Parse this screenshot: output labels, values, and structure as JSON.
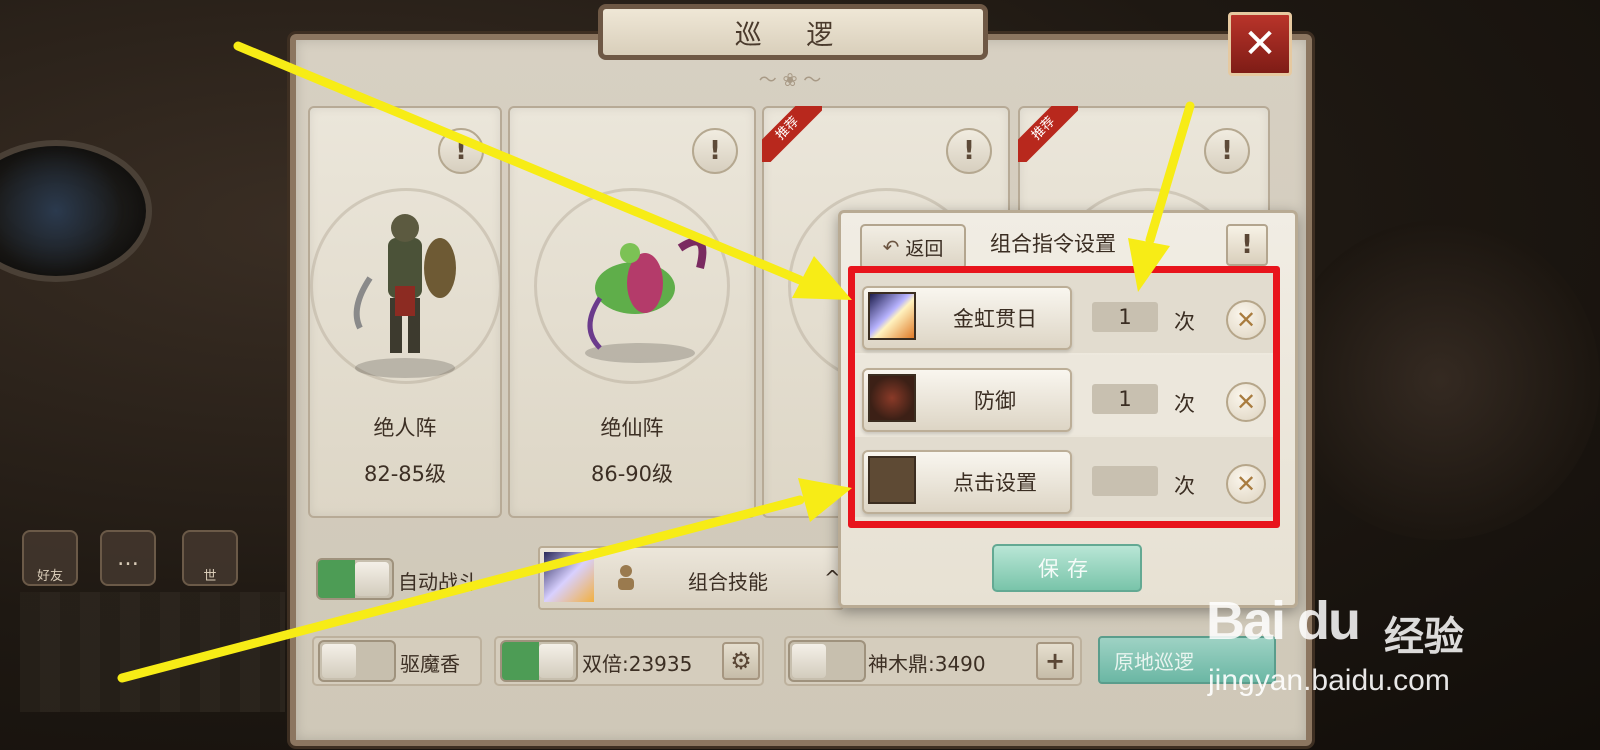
{
  "window": {
    "title": "巡 逻"
  },
  "cards": [
    {
      "name": "绝人阵",
      "level": "82-85级",
      "recommended": false
    },
    {
      "name": "绝仙阵",
      "level": "86-90级",
      "recommended": false
    },
    {
      "name": "",
      "level": "",
      "recommended": true,
      "badge": "推荐"
    },
    {
      "name": "",
      "level": "",
      "recommended": true,
      "badge": "推荐"
    }
  ],
  "left_icons": [
    {
      "label": "好友"
    },
    {
      "label": ""
    },
    {
      "label": "世"
    }
  ],
  "controls": {
    "auto_battle": {
      "label": "自动战斗",
      "on": true
    },
    "combo_skill": {
      "label": "组合技能",
      "caret": "^"
    },
    "exorcism": {
      "label": "驱魔香",
      "on": false
    },
    "double": {
      "label": "双倍:23935",
      "on": true
    },
    "shenmu": {
      "label": "神木鼎:3490",
      "on": false
    },
    "patrol_button": "原地巡逻"
  },
  "popup": {
    "back_label": "返回",
    "title": "组合指令设置",
    "info_glyph": "!",
    "rows": [
      {
        "skill": "金虹贯日",
        "count": "1",
        "unit": "次"
      },
      {
        "skill": "防御",
        "count": "1",
        "unit": "次"
      },
      {
        "skill": "点击设置",
        "count": "",
        "unit": "次"
      }
    ],
    "save_label": "保存"
  },
  "watermark": {
    "logo": "Bai du",
    "cn": "经验",
    "url": "jingyan.baidu.com"
  },
  "colors": {
    "highlight_red": "#e8141c",
    "arrow_yellow": "#f7ec16",
    "toggle_green": "#4d9c55",
    "save_teal": "#79c4aa"
  }
}
